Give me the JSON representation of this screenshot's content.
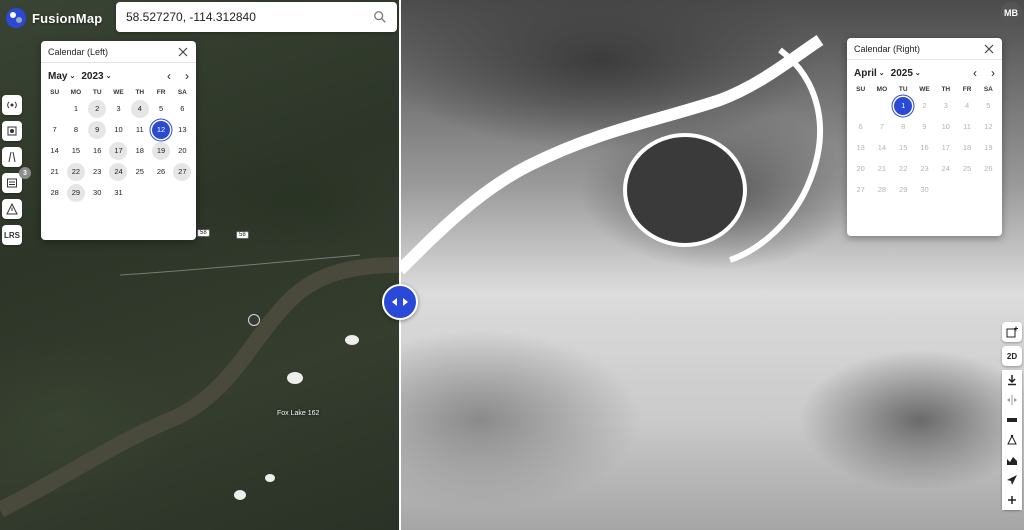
{
  "app": {
    "name": "FusionMap"
  },
  "search": {
    "value": "58.527270, -114.312840"
  },
  "user": {
    "initials": "MB"
  },
  "left_toolbar": [
    {
      "name": "signal-icon",
      "label": ""
    },
    {
      "name": "scan-icon",
      "label": ""
    },
    {
      "name": "road-icon",
      "label": ""
    },
    {
      "name": "list-icon",
      "label": "",
      "badge": "3"
    },
    {
      "name": "warning-icon",
      "label": ""
    },
    {
      "name": "lrs-button",
      "label": "LRS"
    }
  ],
  "right_toolbar": {
    "mode_label": "2D"
  },
  "calendar_left": {
    "title": "Calendar (Left)",
    "month": "May",
    "year": "2023",
    "weekdays": [
      "SU",
      "MO",
      "TU",
      "WE",
      "TH",
      "FR",
      "SA"
    ],
    "offset": 1,
    "days": 31,
    "available": [
      2,
      4,
      9,
      12,
      17,
      19,
      22,
      24,
      27,
      29
    ],
    "selected": 12,
    "disabled": []
  },
  "calendar_right": {
    "title": "Calendar (Right)",
    "month": "April",
    "year": "2025",
    "weekdays": [
      "SU",
      "MO",
      "TU",
      "WE",
      "TH",
      "FR",
      "SA"
    ],
    "offset": 2,
    "days": 30,
    "available": [],
    "selected": 1,
    "disabled_after": 1
  },
  "map": {
    "roads": [
      "58",
      "58"
    ],
    "place": "Fox Lake 162"
  },
  "colors": {
    "accent": "#2a49d6"
  }
}
